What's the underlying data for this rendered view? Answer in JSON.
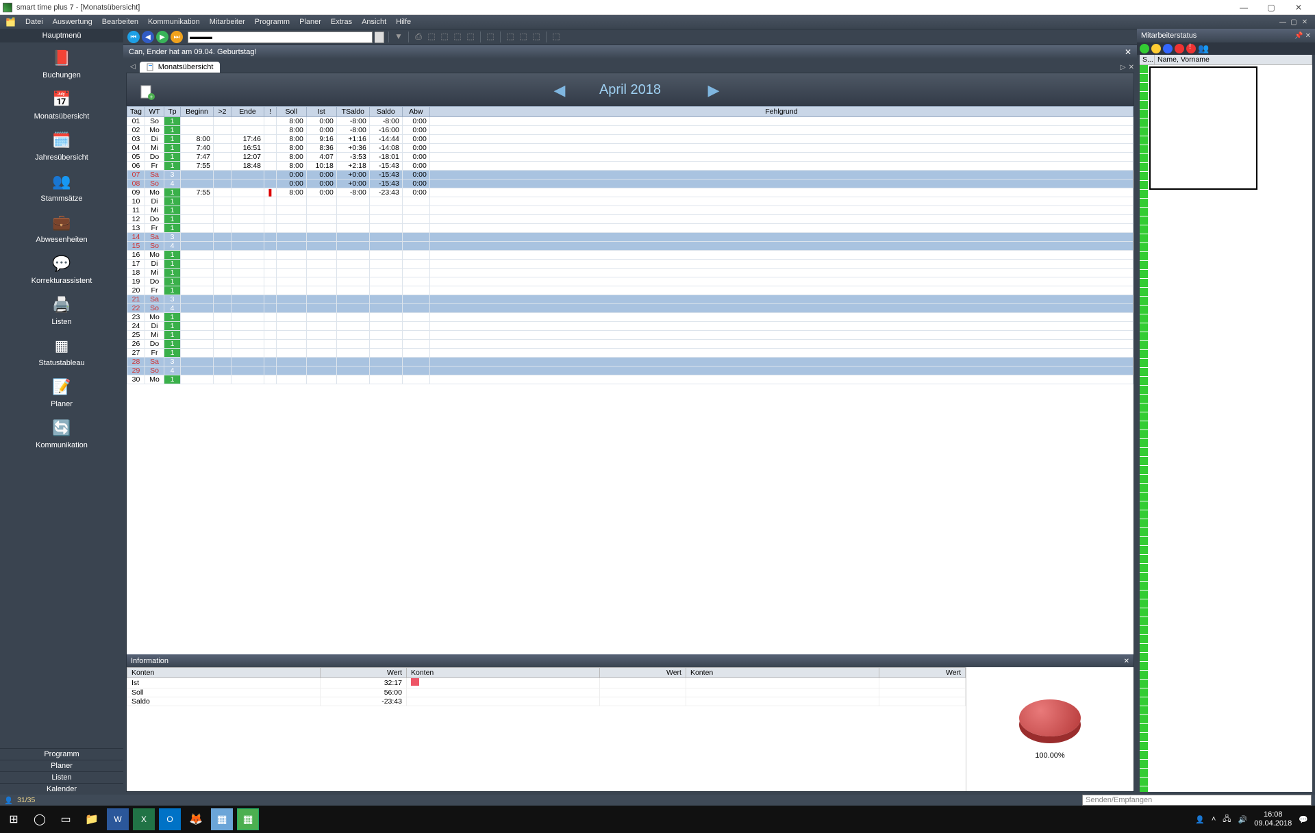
{
  "window": {
    "title": "smart time plus 7 - [Monatsübersicht]"
  },
  "menubar": [
    "Datei",
    "Auswertung",
    "Bearbeiten",
    "Kommunikation",
    "Mitarbeiter",
    "Programm",
    "Planer",
    "Extras",
    "Ansicht",
    "Hilfe"
  ],
  "sidebar_header": "Hauptmenü",
  "sidebar": [
    {
      "label": "Buchungen",
      "icon": "book"
    },
    {
      "label": "Monatsübersicht",
      "icon": "month"
    },
    {
      "label": "Jahresübersicht",
      "icon": "year"
    },
    {
      "label": "Stammsätze",
      "icon": "people"
    },
    {
      "label": "Abwesenheiten",
      "icon": "abs"
    },
    {
      "label": "Korrekturassistent",
      "icon": "fix"
    },
    {
      "label": "Listen",
      "icon": "list"
    },
    {
      "label": "Statustableau",
      "icon": "status"
    },
    {
      "label": "Planer",
      "icon": "planer"
    },
    {
      "label": "Kommunikation",
      "icon": "comm"
    }
  ],
  "sidebar_bottom": [
    "Programm",
    "Planer",
    "Listen",
    "Kalender"
  ],
  "notification": "Can, Ender hat am 09.04. Geburtstag!",
  "tab": "Monatsübersicht",
  "month_title": "April 2018",
  "table_headers": [
    "Tag",
    "WT",
    "Tp",
    "Beginn",
    ">2",
    "Ende",
    "!",
    "Soll",
    "Ist",
    "TSaldo",
    "Saldo",
    "Abw",
    "Fehlgrund"
  ],
  "rows": [
    {
      "tag": "01",
      "wt": "So",
      "tp": "1",
      "beg": "",
      "g2": "",
      "end": "",
      "bang": "",
      "soll": "8:00",
      "ist": "0:00",
      "ts": "-8:00",
      "sal": "-8:00",
      "abw": "0:00",
      "wkend": false
    },
    {
      "tag": "02",
      "wt": "Mo",
      "tp": "1",
      "beg": "",
      "g2": "",
      "end": "",
      "bang": "",
      "soll": "8:00",
      "ist": "0:00",
      "ts": "-8:00",
      "sal": "-16:00",
      "abw": "0:00",
      "wkend": false
    },
    {
      "tag": "03",
      "wt": "Di",
      "tp": "1",
      "beg": "8:00",
      "g2": "",
      "end": "17:46",
      "bang": "",
      "soll": "8:00",
      "ist": "9:16",
      "ts": "+1:16",
      "sal": "-14:44",
      "abw": "0:00",
      "wkend": false
    },
    {
      "tag": "04",
      "wt": "Mi",
      "tp": "1",
      "beg": "7:40",
      "g2": "",
      "end": "16:51",
      "bang": "",
      "soll": "8:00",
      "ist": "8:36",
      "ts": "+0:36",
      "sal": "-14:08",
      "abw": "0:00",
      "wkend": false
    },
    {
      "tag": "05",
      "wt": "Do",
      "tp": "1",
      "beg": "7:47",
      "g2": "",
      "end": "12:07",
      "bang": "",
      "soll": "8:00",
      "ist": "4:07",
      "ts": "-3:53",
      "sal": "-18:01",
      "abw": "0:00",
      "wkend": false
    },
    {
      "tag": "06",
      "wt": "Fr",
      "tp": "1",
      "beg": "7:55",
      "g2": "",
      "end": "18:48",
      "bang": "",
      "soll": "8:00",
      "ist": "10:18",
      "ts": "+2:18",
      "sal": "-15:43",
      "abw": "0:00",
      "wkend": false
    },
    {
      "tag": "07",
      "wt": "Sa",
      "tp": "3",
      "beg": "",
      "g2": "",
      "end": "",
      "bang": "",
      "soll": "0:00",
      "ist": "0:00",
      "ts": "+0:00",
      "sal": "-15:43",
      "abw": "0:00",
      "wkend": true
    },
    {
      "tag": "08",
      "wt": "So",
      "tp": "4",
      "beg": "",
      "g2": "",
      "end": "",
      "bang": "",
      "soll": "0:00",
      "ist": "0:00",
      "ts": "+0:00",
      "sal": "-15:43",
      "abw": "0:00",
      "wkend": true
    },
    {
      "tag": "09",
      "wt": "Mo",
      "tp": "1",
      "beg": "7:55",
      "g2": "",
      "end": "",
      "bang": "!",
      "soll": "8:00",
      "ist": "0:00",
      "ts": "-8:00",
      "sal": "-23:43",
      "abw": "0:00",
      "wkend": false
    },
    {
      "tag": "10",
      "wt": "Di",
      "tp": "1",
      "wkend": false
    },
    {
      "tag": "11",
      "wt": "Mi",
      "tp": "1",
      "wkend": false
    },
    {
      "tag": "12",
      "wt": "Do",
      "tp": "1",
      "wkend": false
    },
    {
      "tag": "13",
      "wt": "Fr",
      "tp": "1",
      "wkend": false
    },
    {
      "tag": "14",
      "wt": "Sa",
      "tp": "3",
      "wkend": true
    },
    {
      "tag": "15",
      "wt": "So",
      "tp": "4",
      "wkend": true
    },
    {
      "tag": "16",
      "wt": "Mo",
      "tp": "1",
      "wkend": false
    },
    {
      "tag": "17",
      "wt": "Di",
      "tp": "1",
      "wkend": false
    },
    {
      "tag": "18",
      "wt": "Mi",
      "tp": "1",
      "wkend": false
    },
    {
      "tag": "19",
      "wt": "Do",
      "tp": "1",
      "wkend": false
    },
    {
      "tag": "20",
      "wt": "Fr",
      "tp": "1",
      "wkend": false
    },
    {
      "tag": "21",
      "wt": "Sa",
      "tp": "3",
      "wkend": true
    },
    {
      "tag": "22",
      "wt": "So",
      "tp": "4",
      "wkend": true
    },
    {
      "tag": "23",
      "wt": "Mo",
      "tp": "1",
      "wkend": false
    },
    {
      "tag": "24",
      "wt": "Di",
      "tp": "1",
      "wkend": false
    },
    {
      "tag": "25",
      "wt": "Mi",
      "tp": "1",
      "wkend": false
    },
    {
      "tag": "26",
      "wt": "Do",
      "tp": "1",
      "wkend": false
    },
    {
      "tag": "27",
      "wt": "Fr",
      "tp": "1",
      "wkend": false
    },
    {
      "tag": "28",
      "wt": "Sa",
      "tp": "3",
      "wkend": true
    },
    {
      "tag": "29",
      "wt": "So",
      "tp": "4",
      "wkend": true
    },
    {
      "tag": "30",
      "wt": "Mo",
      "tp": "1",
      "wkend": false
    }
  ],
  "info_panel_title": "Information",
  "info_headers": [
    "Konten",
    "Wert",
    "Konten",
    "Wert",
    "Konten",
    "Wert"
  ],
  "info_rows": [
    {
      "k": "Ist",
      "v": "32:17",
      "swatch": true
    },
    {
      "k": "Soll",
      "v": "56:00"
    },
    {
      "k": "Saldo",
      "v": "-23:43"
    }
  ],
  "chart_data": {
    "type": "pie",
    "series": [
      {
        "name": "Ist",
        "value": 100.0,
        "color": "#cc4a4a"
      }
    ],
    "label": "100.00%"
  },
  "right_panel_title": "Mitarbeiterstatus",
  "right_headers": [
    "S...",
    "Name, Vorname"
  ],
  "status_counter": "31/35",
  "send_placeholder": "Senden/Empfangen",
  "clock": {
    "time": "16:08",
    "date": "09.04.2018"
  }
}
